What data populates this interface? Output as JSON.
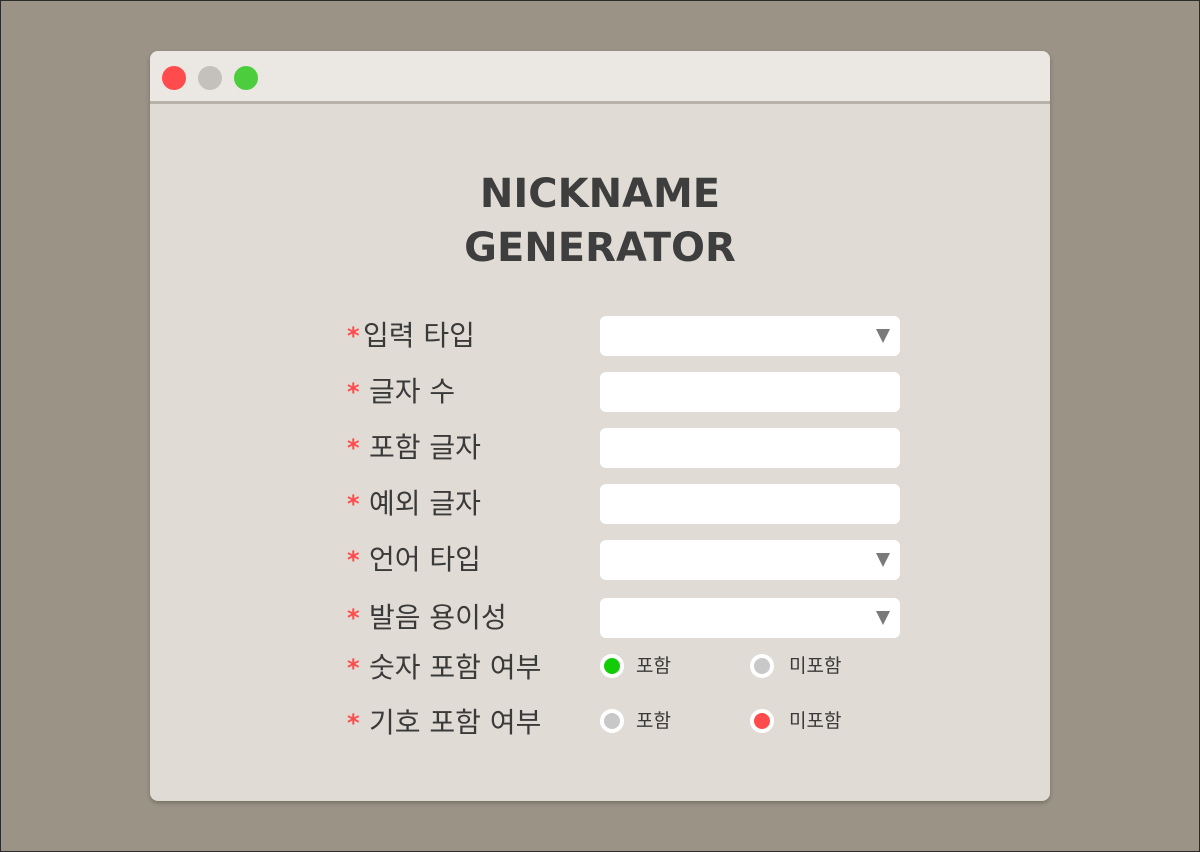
{
  "window": {
    "controls": [
      "close",
      "minimize",
      "maximize"
    ]
  },
  "title": {
    "line1": "NICKNAME",
    "line2": "GENERATOR"
  },
  "form": {
    "required_mark": "*",
    "fields": [
      {
        "label": "입력 타입",
        "type": "select",
        "value": ""
      },
      {
        "label": "글자 수",
        "type": "text",
        "value": ""
      },
      {
        "label": "포함 글자",
        "type": "text",
        "value": ""
      },
      {
        "label": "예외 글자",
        "type": "text",
        "value": ""
      },
      {
        "label": "언어 타입",
        "type": "select",
        "value": ""
      },
      {
        "label": "발음 용이성",
        "type": "select",
        "value": ""
      }
    ],
    "radio_groups": [
      {
        "label": "숫자 포함 여부",
        "options": [
          "포함",
          "미포함"
        ],
        "selected": "포함"
      },
      {
        "label": "기호 포함 여부",
        "options": [
          "포함",
          "미포함"
        ],
        "selected": "미포함"
      }
    ]
  },
  "colors": {
    "background": "#9b9386",
    "window": "#e0dcd5",
    "required": "#ff4b4b",
    "radio_selected_number": "#13cc08",
    "radio_selected_symbol": "#ff4b4b"
  }
}
